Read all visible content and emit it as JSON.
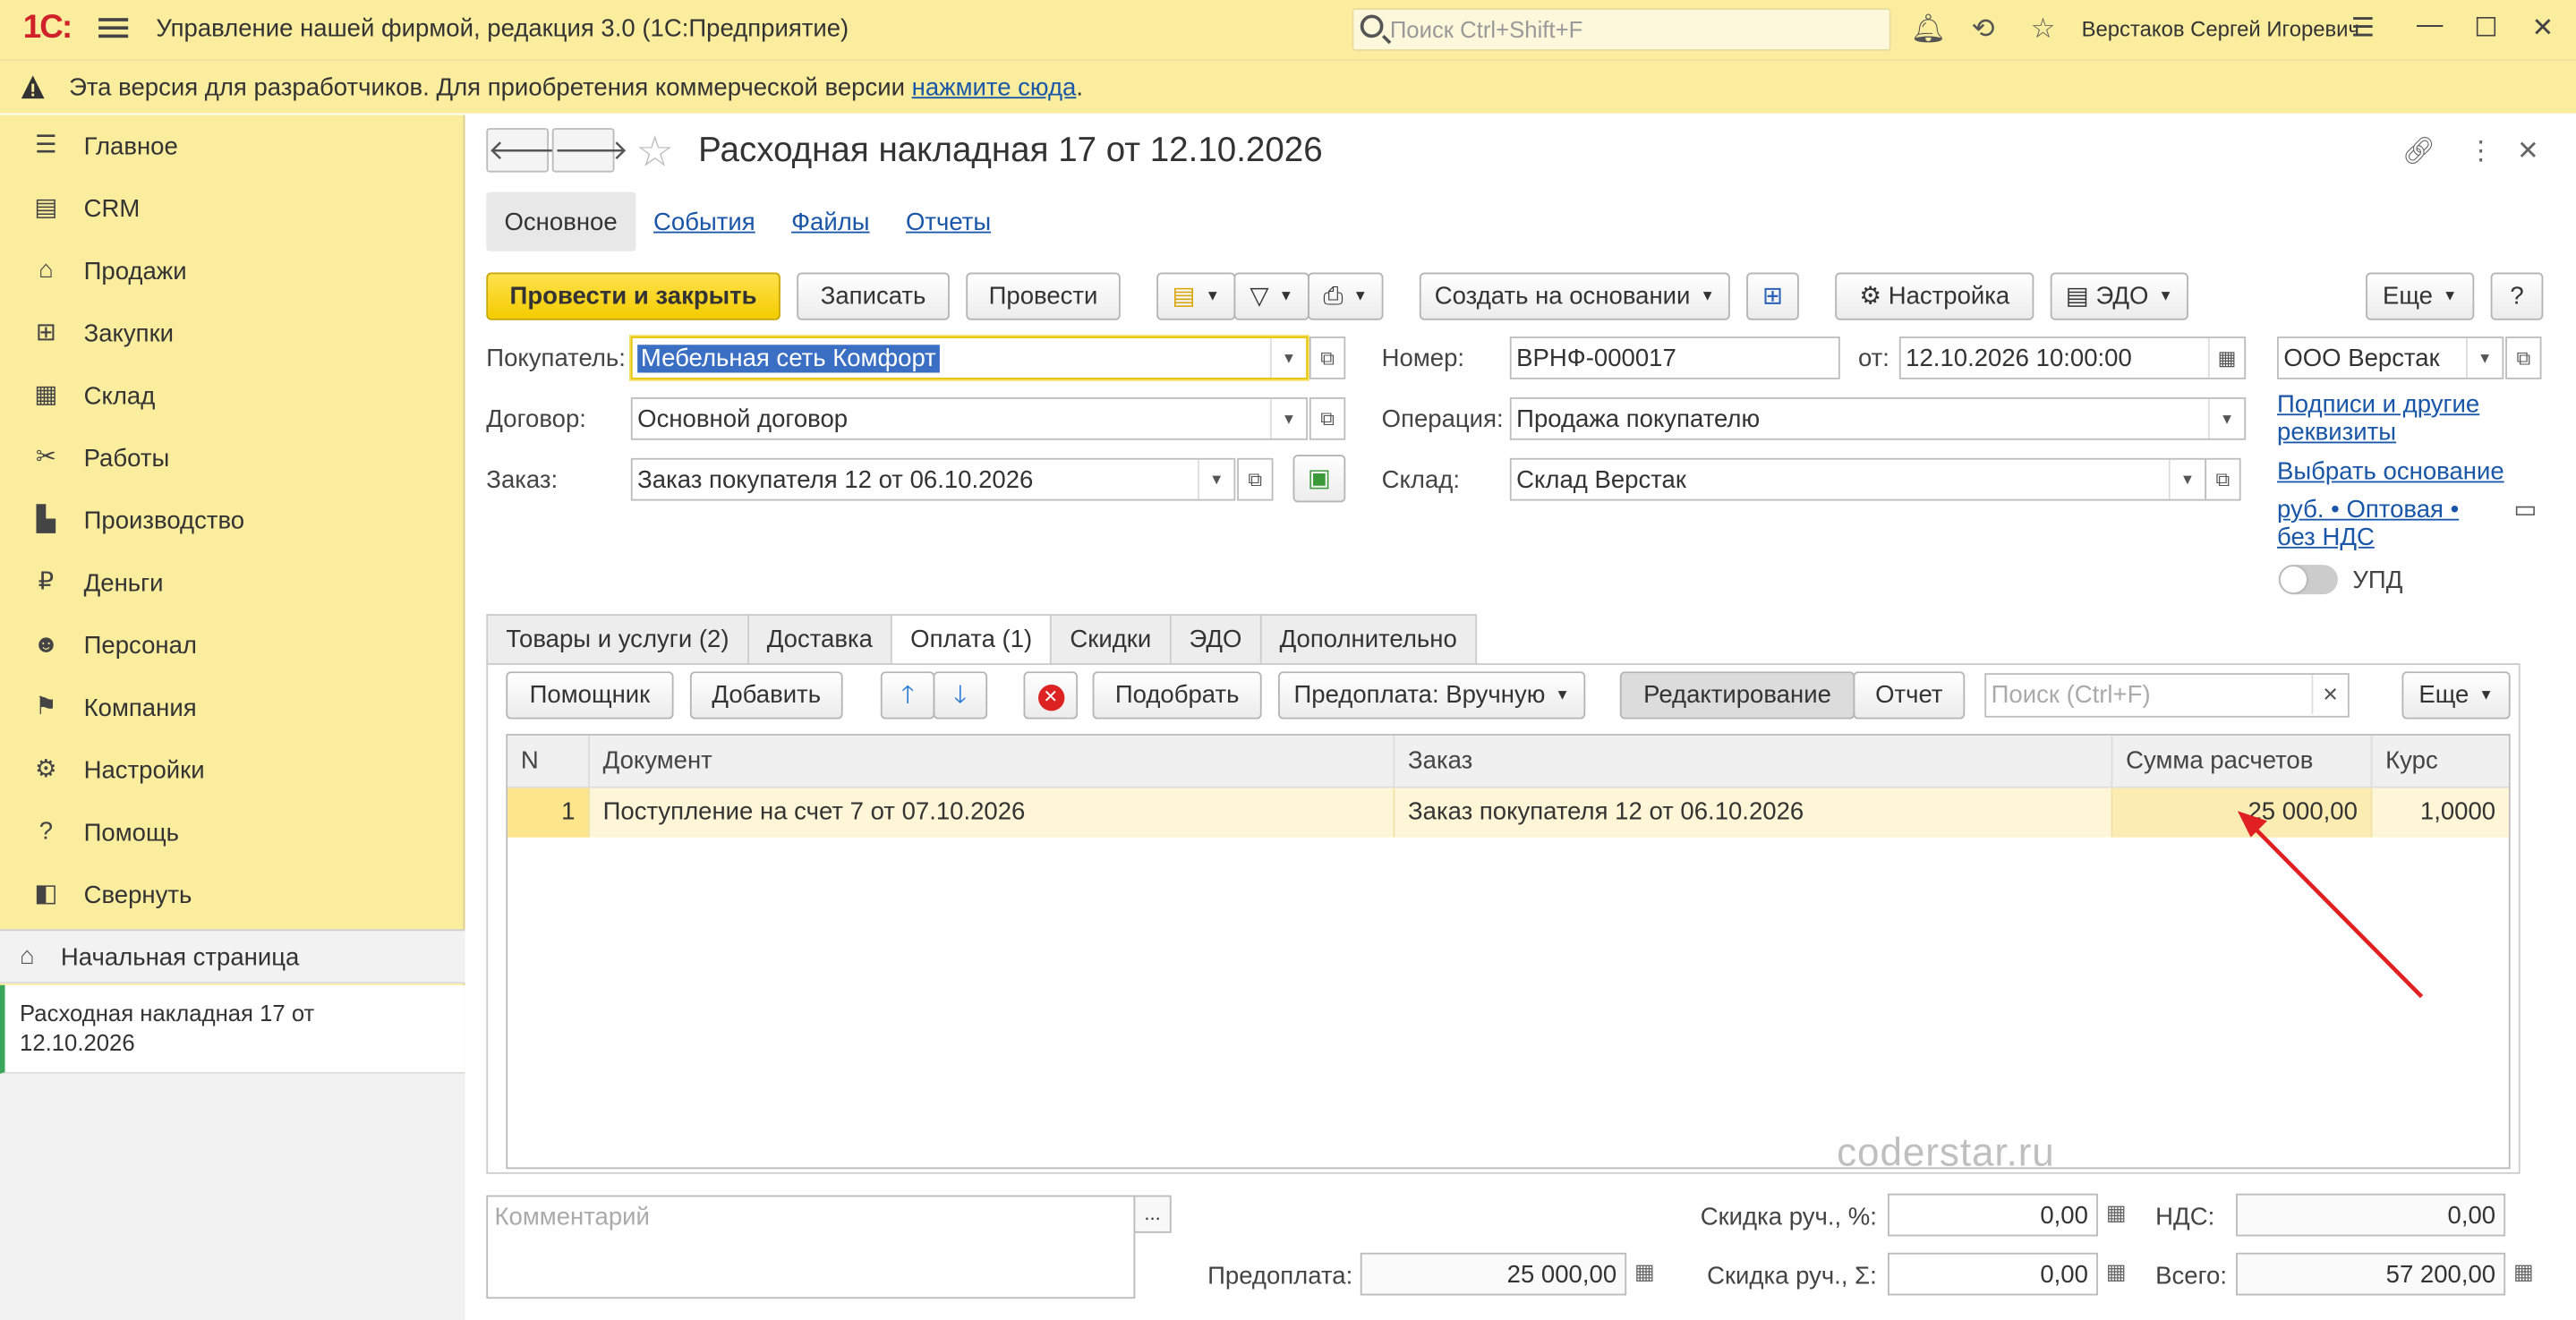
{
  "app": {
    "logo": "1С:",
    "title": "Управление нашей фирмой, редакция 3.0  (1С:Предприятие)",
    "search_placeholder": "Поиск Ctrl+Shift+F",
    "user": "Верстаков Сергей Игоревич"
  },
  "banner": {
    "text": "Эта версия для разработчиков. Для приобретения коммерческой версии ",
    "link": "нажмите сюда",
    "tail": "."
  },
  "sidebar": {
    "items": [
      {
        "label": "Главное",
        "icon": "menu-lines-icon"
      },
      {
        "label": "CRM",
        "icon": "contacts-icon"
      },
      {
        "label": "Продажи",
        "icon": "basket-icon"
      },
      {
        "label": "Закупки",
        "icon": "cart-icon"
      },
      {
        "label": "Склад",
        "icon": "warehouse-icon"
      },
      {
        "label": "Работы",
        "icon": "tools-icon"
      },
      {
        "label": "Производство",
        "icon": "factory-icon"
      },
      {
        "label": "Деньги",
        "icon": "ruble-icon"
      },
      {
        "label": "Персонал",
        "icon": "people-icon"
      },
      {
        "label": "Компания",
        "icon": "flag-icon"
      },
      {
        "label": "Настройки",
        "icon": "gear-icon"
      },
      {
        "label": "Помощь",
        "icon": "help-icon"
      },
      {
        "label": "Свернуть",
        "icon": "collapse-icon"
      }
    ],
    "home": "Начальная страница",
    "open_doc": "Расходная накладная 17 от 12.10.2026"
  },
  "form": {
    "title": "Расходная накладная 17 от 12.10.2026",
    "tabs": [
      "Основное",
      "События",
      "Файлы",
      "Отчеты"
    ],
    "toolbar": {
      "post_close": "Провести и закрыть",
      "save": "Записать",
      "post": "Провести",
      "create_based": "Создать на основании",
      "settings": "Настройка",
      "edo": "ЭДО",
      "more": "Еще",
      "help": "?"
    },
    "fields": {
      "buyer_label": "Покупатель:",
      "buyer": "Мебельная сеть Комфорт",
      "contract_label": "Договор:",
      "contract": "Основной договор",
      "order_label": "Заказ:",
      "order": "Заказ покупателя 12 от 06.10.2026",
      "number_label": "Номер:",
      "number": "ВРНФ-000017",
      "date_label": "от:",
      "date": "12.10.2026 10:00:00",
      "operation_label": "Операция:",
      "operation": "Продажа покупателю",
      "warehouse_label": "Склад:",
      "warehouse": "Склад Верстак",
      "company": "ООО Верстак"
    },
    "links": {
      "signatures": "Подписи и другие реквизиты",
      "choose_basis": "Выбрать основание",
      "price_info": "руб. • Оптовая • без НДС"
    },
    "upd_label": "УПД",
    "subtabs": [
      "Товары и услуги (2)",
      "Доставка",
      "Оплата (1)",
      "Скидки",
      "ЭДО",
      "Дополнительно"
    ],
    "payment_toolbar": {
      "helper": "Помощник",
      "add": "Добавить",
      "pick": "Подобрать",
      "prepay": "Предоплата: Вручную",
      "editing": "Редактирование",
      "report": "Отчет",
      "search_placeholder": "Поиск (Ctrl+F)",
      "more": "Еще"
    },
    "table": {
      "columns": [
        "N",
        "Документ",
        "Заказ",
        "Сумма расчетов",
        "Курс"
      ],
      "rows": [
        {
          "n": "1",
          "document": "Поступление на счет 7 от 07.10.2026",
          "order": "Заказ покупателя 12 от 06.10.2026",
          "sum": "25 000,00",
          "rate": "1,0000"
        }
      ]
    },
    "footer": {
      "comment_placeholder": "Комментарий",
      "prepay_label": "Предоплата:",
      "prepay": "25 000,00",
      "disc_pct_label": "Скидка руч., %:",
      "disc_pct": "0,00",
      "disc_sum_label": "Скидка руч., Σ:",
      "disc_sum": "0,00",
      "vat_label": "НДС:",
      "vat": "0,00",
      "total_label": "Всего:",
      "total": "57 200,00"
    }
  },
  "watermark": "coderstar.ru",
  "colors": {
    "accent_yellow": "#fbed9e",
    "primary_button": "#f4cc00",
    "link": "#1a56a8",
    "arrow": "#e02020"
  }
}
